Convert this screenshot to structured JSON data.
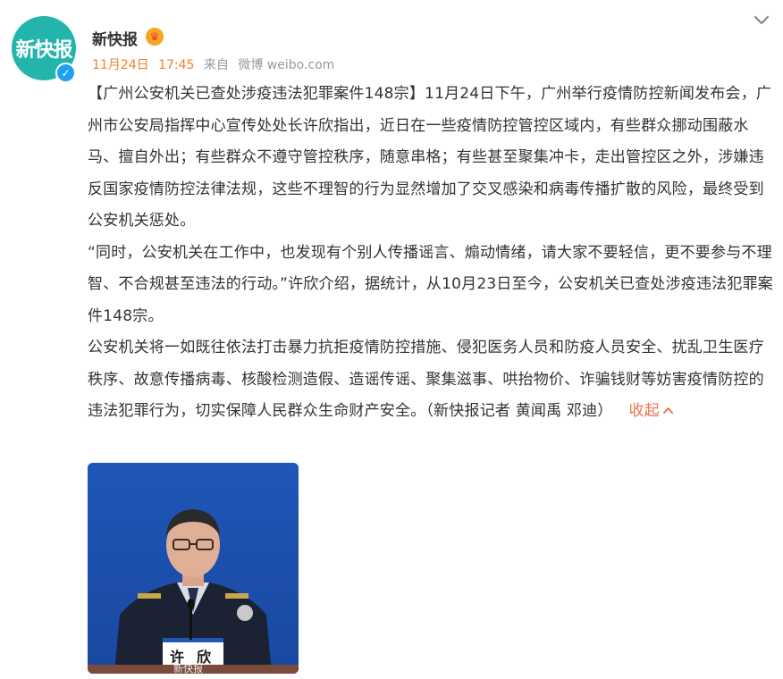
{
  "author": {
    "avatar_text": "新快报",
    "name": "新快报",
    "verified_glyph": "✓"
  },
  "meta": {
    "date": "11月24日",
    "time": "17:45",
    "source_prefix": "来自",
    "source": "微博 weibo.com"
  },
  "post": {
    "paragraphs": [
      "【广州公安机关已查处涉疫违法犯罪案件148宗】11月24日下午，广州举行疫情防控新闻发布会，广州市公安局指挥中心宣传处处长许欣指出，近日在一些疫情防控管控区域内，有些群众挪动围蔽水马、擅自外出；有些群众不遵守管控秩序，随意串格；有些甚至聚集冲卡，走出管控区之外，涉嫌违反国家疫情防控法律法规，这些不理智的行为显然增加了交叉感染和病毒传播扩散的风险，最终受到公安机关惩处。",
      "“同时，公安机关在工作中，也发现有个别人传播谣言、煽动情绪，请大家不要轻信，更不要参与不理智、不合规甚至违法的行动。”许欣介绍，据统计，从10月23日至今，公安机关已查处涉疫违法犯罪案件148宗。"
    ],
    "last_paragraph": "公安机关将一如既往依法打击暴力抗拒疫情防控措施、侵犯医务人员和防疫人员安全、扰乱卫生医疗秩序、故意传播病毒、核酸检测造假、造谣传谣、聚集滋事、哄抬物价、诈骗钱财等妨害疫情防控的违法犯罪行为，切实保障人民群众生命财产安全。（新快报记者 黄闻禹 邓迪）",
    "collapse_label": "收起",
    "photo": {
      "nameplate": "许欣",
      "watermark": "新快报"
    }
  },
  "icons": {
    "chevron": "chevron-down-icon",
    "member": "member-crown-icon",
    "verified": "verified-badge-icon"
  },
  "colors": {
    "accent_orange": "#f07f2c",
    "link": "#eb7350",
    "avatar_teal": "#23b5ab",
    "photo_blue": "#1f4ea8"
  }
}
